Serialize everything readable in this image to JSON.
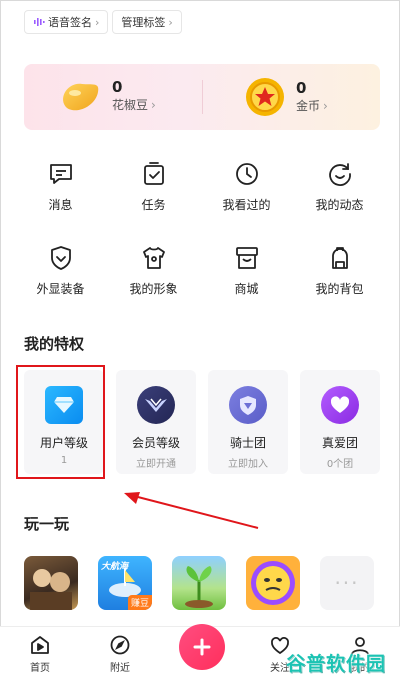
{
  "tags": [
    {
      "label": "语音签名",
      "icon": "waveform-icon"
    },
    {
      "label": "管理标签"
    }
  ],
  "wallet": {
    "bean": {
      "count": "0",
      "label": "花椒豆"
    },
    "coin": {
      "count": "0",
      "label": "金币"
    }
  },
  "grid": [
    {
      "label": "消息",
      "icon": "message-icon"
    },
    {
      "label": "任务",
      "icon": "task-icon"
    },
    {
      "label": "我看过的",
      "icon": "clock-icon"
    },
    {
      "label": "我的动态",
      "icon": "refresh-smile-icon"
    },
    {
      "label": "外显装备",
      "icon": "shield-check-icon"
    },
    {
      "label": "我的形象",
      "icon": "tshirt-icon"
    },
    {
      "label": "商城",
      "icon": "store-icon"
    },
    {
      "label": "我的背包",
      "icon": "bag-icon"
    }
  ],
  "privileges_title": "我的特权",
  "privileges": [
    {
      "title": "用户等级",
      "sub": "1",
      "icon": "diamond-icon"
    },
    {
      "title": "会员等级",
      "sub": "立即开通",
      "icon": "vip-wings-icon"
    },
    {
      "title": "骑士团",
      "sub": "立即加入",
      "icon": "knight-emblem-icon"
    },
    {
      "title": "真爱团",
      "sub": "0个团",
      "icon": "heart-hands-icon"
    }
  ],
  "games_title": "玩一玩",
  "games": [
    {
      "icon": "game-icon-1"
    },
    {
      "title": "大航海",
      "badge": "赚豆",
      "icon": "game-icon-2"
    },
    {
      "icon": "game-icon-3"
    },
    {
      "icon": "game-icon-4"
    },
    {
      "icon": "more-icon"
    }
  ],
  "tabbar": [
    {
      "label": "首页",
      "icon": "home-play-icon"
    },
    {
      "label": "附近",
      "icon": "compass-icon"
    },
    {
      "label": "",
      "icon": "plus-icon"
    },
    {
      "label": "关注",
      "icon": "follow-icon"
    },
    {
      "label": "我的",
      "icon": "profile-icon"
    }
  ],
  "watermark": "谷普软件园",
  "colors": {
    "highlight": "#e0161b",
    "accent": "#ff3366",
    "watermark": "#1cc3b3"
  }
}
